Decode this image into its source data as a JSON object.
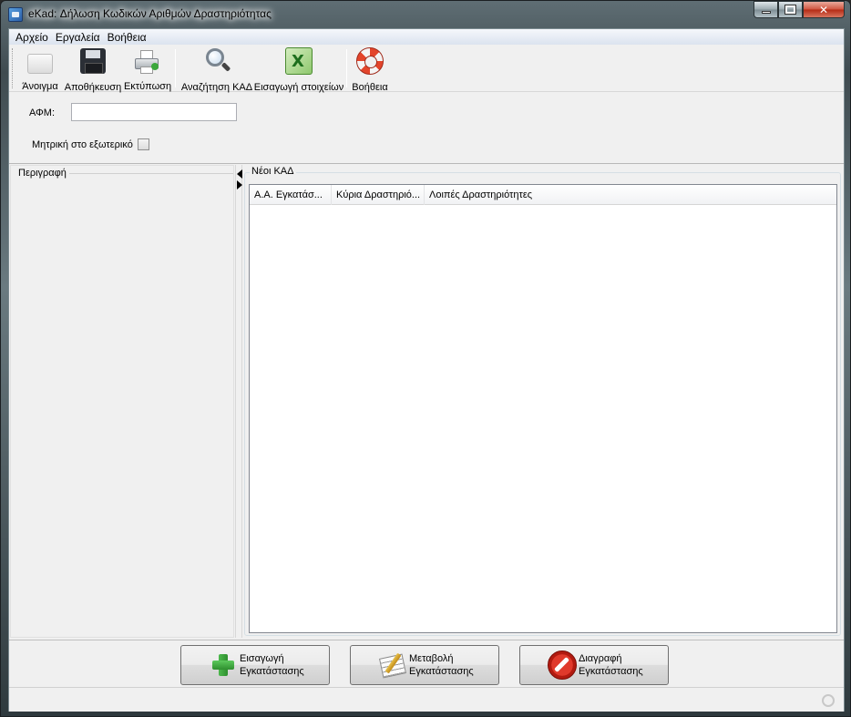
{
  "window": {
    "title": "eKad: Δήλωση Κωδικών Αριθμών Δραστηριότητας",
    "minimize": "",
    "maximize": "",
    "close": "✕"
  },
  "menu": {
    "items": [
      {
        "label": "Αρχείο"
      },
      {
        "label": "Εργαλεία"
      },
      {
        "label": "Βοήθεια"
      }
    ]
  },
  "toolbar": {
    "open": "Άνοιγμα",
    "save": "Αποθήκευση",
    "print": "Εκτύπωση",
    "search_kad": "Αναζήτηση ΚΑΔ",
    "import_data": "Εισαγωγή στοιχείων",
    "help": "Βοήθεια",
    "icons": [
      "folder-icon",
      "floppy-disk-icon",
      "printer-icon",
      "magnifier-icon",
      "excel-icon",
      "lifebuoy-icon"
    ]
  },
  "form": {
    "afm_label": "ΑΦΜ:",
    "afm_value": "",
    "foreign_label": "Μητρική στο εξωτερικό",
    "foreign_checked": false
  },
  "left_panel": {
    "title": "Περιγραφή"
  },
  "right_panel": {
    "title": "Νέοι ΚΑΔ",
    "columns": [
      "Α.Α. Εγκατάσ...",
      "Κύρια Δραστηριό...",
      "Λοιπές Δραστηριότητες"
    ],
    "rows": []
  },
  "buttons": {
    "insert_line1": "Εισαγωγή",
    "insert_line2": "Εγκατάστασης",
    "modify_line1": "Μεταβολή",
    "modify_line2": "Εγκατάστασης",
    "delete_line1": "Διαγραφή",
    "delete_line2": "Εγκατάστασης"
  },
  "colors": {
    "title_glass": "#4f5e64",
    "client_bg": "#f0f0f0",
    "close_red": "#c8412b",
    "add_green": "#3ca83c",
    "delete_red": "#d12e20"
  }
}
